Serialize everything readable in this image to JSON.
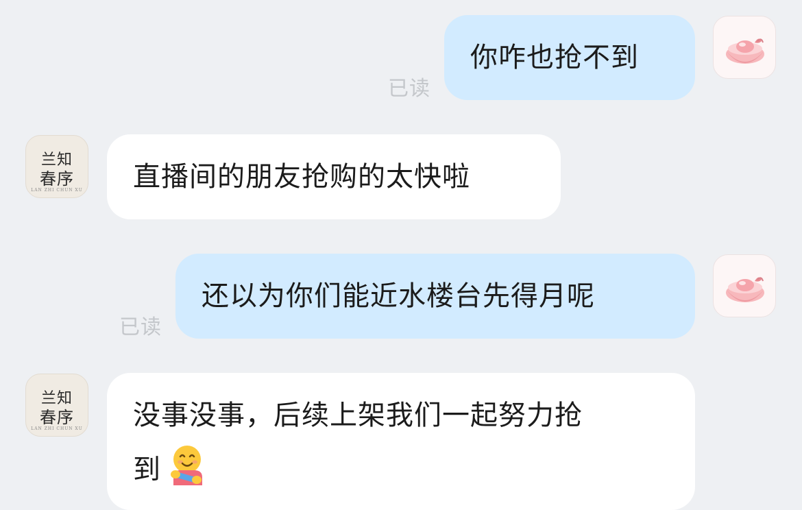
{
  "messages": [
    {
      "sender": "self",
      "text": "你咋也抢不到",
      "status": "已读"
    },
    {
      "sender": "other",
      "text": "直播间的朋友抢购的太快啦"
    },
    {
      "sender": "self",
      "text": "还以为你们能近水楼台先得月呢",
      "status": "已读"
    },
    {
      "sender": "other",
      "line1": "没事没事，后续上架我们一起努力抢",
      "line2": "到",
      "emoji": "hugging-face-emoji"
    }
  ],
  "brand_avatar": {
    "line1": "兰知",
    "line2": "春序",
    "subtitle": "LAN ZHI CHUN XU"
  },
  "self_avatar": {
    "icon": "pink-ingot-icon"
  },
  "colors": {
    "background": "#eef0f3",
    "self_bubble": "#d2ebff",
    "other_bubble": "#ffffff",
    "read_status": "#c4c7cb"
  }
}
